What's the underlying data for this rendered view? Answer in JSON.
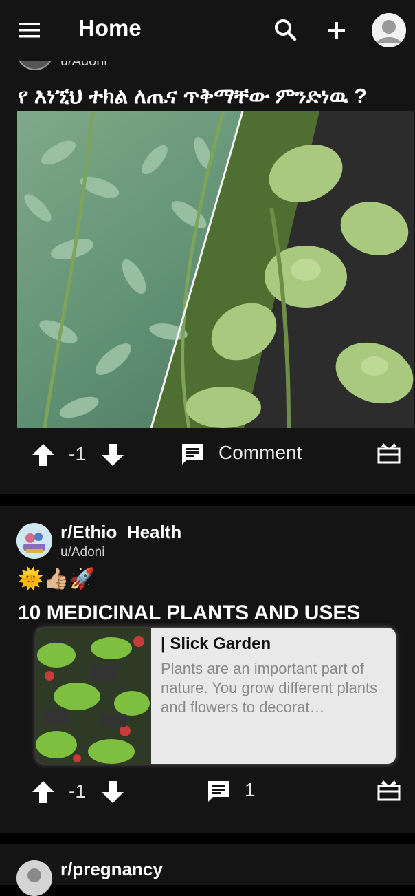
{
  "header": {
    "title": "Home",
    "icons": [
      "menu-icon",
      "search-icon",
      "add-icon",
      "profile-avatar"
    ]
  },
  "posts": [
    {
      "user": "u/Adoni",
      "title": "የ እነኚህ ተክል ለጤና ጥቅማቸው ምንድነዉ ?",
      "score": "-1",
      "comment_label": "Comment"
    },
    {
      "subreddit": "r/Ethio_Health",
      "user": "u/Adoni",
      "emojis": "🌞👍🏼🚀",
      "title": "10 MEDICINAL PLANTS AND USES",
      "link_site": "| Slick Garden",
      "link_desc": "Plants are an important part of nature. You grow different plants and flowers to decorat…",
      "score": "-1",
      "comment_count": "1"
    },
    {
      "subreddit": "r/pregnancy"
    }
  ],
  "colors": {
    "background": "#000000",
    "card": "#141414",
    "text": "#ffffff",
    "link_card": "#e9e9e9"
  }
}
